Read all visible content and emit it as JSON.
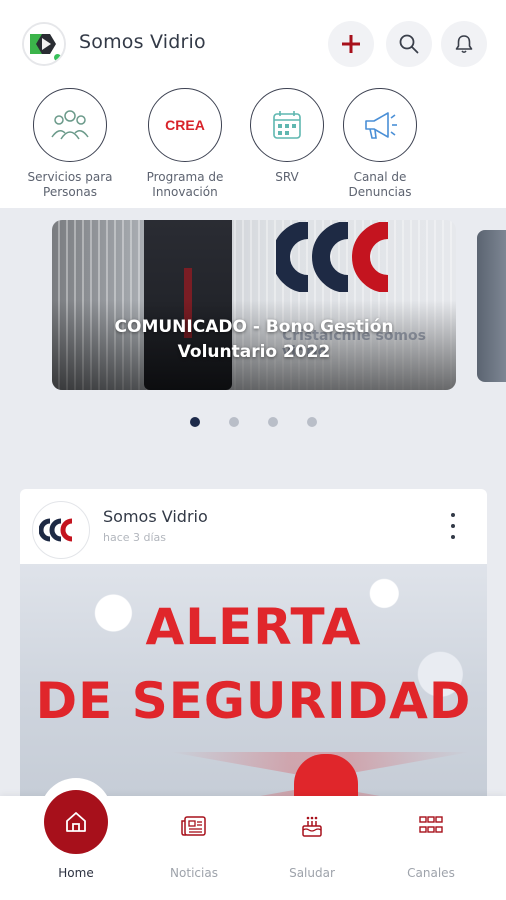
{
  "header": {
    "title": "Somos Vidrio",
    "actions": [
      "plus-icon",
      "search-icon",
      "bell-icon"
    ],
    "online_status_color": "#37c05a"
  },
  "quick_links": [
    {
      "label": "Servicios para Personas",
      "icon": "people-icon"
    },
    {
      "label": "Programa de Innovación",
      "icon": "crea-logo",
      "logo_text": "CREA"
    },
    {
      "label": "SRV",
      "icon": "calendar-icon"
    },
    {
      "label": "Canal de Denuncias",
      "icon": "megaphone-icon"
    }
  ],
  "carousel": {
    "slides": [
      {
        "caption": "COMUNICADO - Bono Gestión Voluntario 2022",
        "background_text": "Cristalchile somos vidrio"
      }
    ],
    "dot_count": 4,
    "active_index": 0
  },
  "post": {
    "author": "Somos Vidrio",
    "time": "hace 3 días",
    "image_lines": [
      "ALERTA",
      "DE SEGURIDAD"
    ]
  },
  "bottom_nav": [
    {
      "label": "Home",
      "icon": "home-icon",
      "active": true
    },
    {
      "label": "Noticias",
      "icon": "newspaper-icon",
      "active": false
    },
    {
      "label": "Saludar",
      "icon": "cake-icon",
      "active": false
    },
    {
      "label": "Canales",
      "icon": "grid-icon",
      "active": false
    }
  ],
  "colors": {
    "brand_red": "#a7101b",
    "navy": "#1d2a4a",
    "alert_red": "#e0262b"
  }
}
